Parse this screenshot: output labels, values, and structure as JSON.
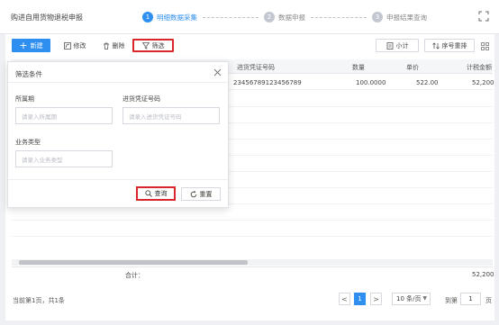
{
  "header": {
    "title": "购进自用货物退税申报",
    "steps": [
      {
        "num": "1",
        "label": "明细数据采集"
      },
      {
        "num": "2",
        "label": "数据申报"
      },
      {
        "num": "3",
        "label": "申报结果查询"
      }
    ]
  },
  "toolbar": {
    "new_label": "新建",
    "edit_label": "修改",
    "delete_label": "删除",
    "filter_label": "筛选",
    "subtotal_label": "小计",
    "sort_label": "序号重排"
  },
  "table": {
    "columns": [
      "进货凭证号码",
      "数量",
      "单价",
      "计税金额"
    ],
    "rows": [
      {
        "voucher": "23456789123456789",
        "qty": "100.0000",
        "price": "522.00",
        "amount": "52,200"
      }
    ],
    "sum_label": "合计：",
    "sum_amount": "52,200"
  },
  "footer": {
    "record_text": "当前第1页，共1条",
    "prev": "<",
    "page": "1",
    "next": ">",
    "page_size": "10 条/页",
    "goto_label": "到第",
    "goto_value": "1",
    "goto_unit": "页"
  },
  "filter_popup": {
    "title": "筛选条件",
    "period_label": "所属期",
    "period_placeholder": "请录入所属期",
    "voucher_label": "进货凭证号码",
    "voucher_placeholder": "请录入进货凭证号码",
    "biz_label": "业务类型",
    "biz_placeholder": "请录入业务类型",
    "query_label": "查询",
    "reset_label": "重置"
  },
  "colors": {
    "primary": "#2f8ff0",
    "highlight": "#d9262b"
  }
}
